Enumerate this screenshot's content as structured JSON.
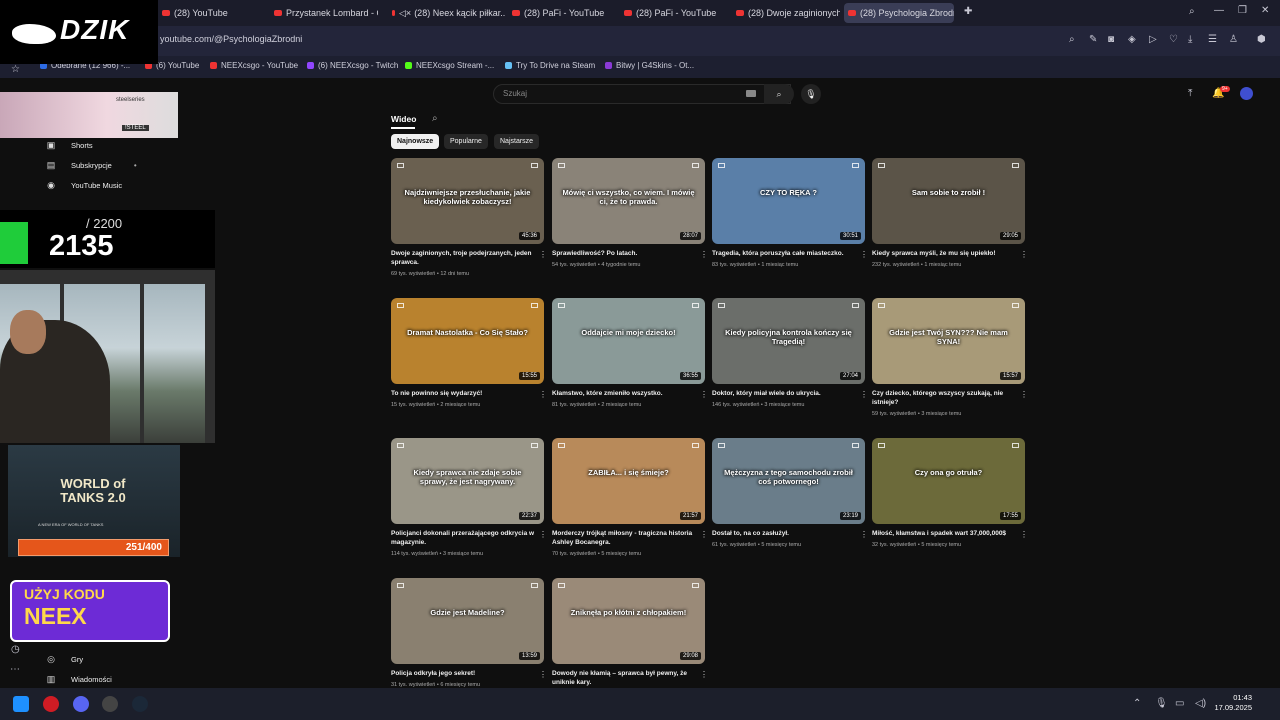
{
  "tabs": [
    {
      "label": "(28) YouTube"
    },
    {
      "label": "Przystanek Lombard - Od..."
    },
    {
      "label": "(28) Neex kącik piłkar..."
    },
    {
      "label": "(28) PaFi - YouTube"
    },
    {
      "label": "(28) PaFi - YouTube"
    },
    {
      "label": "(28) Dwoje zaginionych, t..."
    },
    {
      "label": "(28) Psychologia Zbrodni"
    }
  ],
  "address": {
    "url": "youtube.com/@PsychologiaZbrodni"
  },
  "bookmarks": [
    {
      "label": "Odebrane (12 966) -...",
      "color": "#2d6be4"
    },
    {
      "label": "(6) YouTube",
      "color": "#e33"
    },
    {
      "label": "NEEXcsgo - YouTube",
      "color": "#e33"
    },
    {
      "label": "(6) NEEXcsgo - Twitch",
      "color": "#9146ff"
    },
    {
      "label": "NEEXcsgo Stream -...",
      "color": "#53fc18"
    },
    {
      "label": "Try To Drive na Steam",
      "color": "#66c0f4"
    },
    {
      "label": "Bitwy | G4Skins - Ot...",
      "color": "#8a3ad6"
    }
  ],
  "search": {
    "placeholder": "Szukaj"
  },
  "sidebar": {
    "items": [
      {
        "label": "Shorts",
        "icon": "shorts-icon"
      },
      {
        "label": "Subskrypcje",
        "icon": "subscriptions-icon"
      },
      {
        "label": "YouTube Music",
        "icon": "music-icon"
      },
      {
        "label": "Gry",
        "icon": "games-icon"
      },
      {
        "label": "Wiadomości",
        "icon": "news-icon"
      }
    ]
  },
  "channel": {
    "tab_label": "Wideo",
    "chips": [
      "Najnowsze",
      "Popularne",
      "Najstarsze"
    ]
  },
  "videos": [
    {
      "title": "Dwoje zaginionych, troje podejrzanych, jeden sprawca.",
      "views": "69 tys. wyświetleń",
      "age": "12 dni temu",
      "duration": "45:36",
      "caption": "Najdziwniejsze przesłuchanie, jakie kiedykolwiek zobaczysz!",
      "bg": "#6a6050"
    },
    {
      "title": "Sprawiedliwość? Po latach.",
      "views": "54 tys. wyświetleń",
      "age": "4 tygodnie temu",
      "duration": "28:07",
      "caption": "Mówię ci wszystko, co wiem. I mówię ci, że to prawda.",
      "bg": "#8a8378"
    },
    {
      "title": "Tragedia, która poruszyła całe miasteczko.",
      "views": "83 tys. wyświetleń",
      "age": "1 miesiąc temu",
      "duration": "30:51",
      "caption": "CZY TO RĘKA ?",
      "bg": "#5a7fa8"
    },
    {
      "title": "Kiedy sprawca myśli, że mu się upiekło!",
      "views": "232 tys. wyświetleń",
      "age": "1 miesiąc temu",
      "duration": "29:05",
      "caption": "Sam sobie to zrobił !",
      "bg": "#5b5448"
    },
    {
      "title": "To nie powinno się wydarzyć!",
      "views": "15 tys. wyświetleń",
      "age": "2 miesiące temu",
      "duration": "15:55",
      "caption": "Dramat Nastolatka - Co Się Stało?",
      "bg": "#b9822e"
    },
    {
      "title": "Kłamstwo, które zmieniło wszystko.",
      "views": "81 tys. wyświetleń",
      "age": "2 miesiące temu",
      "duration": "36:55",
      "caption": "Oddajcie mi moje dziecko!",
      "bg": "#8a9a98"
    },
    {
      "title": "Doktor, który miał wiele do ukrycia.",
      "views": "146 tys. wyświetleń",
      "age": "3 miesiące temu",
      "duration": "27:04",
      "caption": "Kiedy policyjna kontrola kończy się Tragedią!",
      "bg": "#6b6e6a"
    },
    {
      "title": "Czy dziecko, którego wszyscy szukają, nie istnieje?",
      "views": "59 tys. wyświetleń",
      "age": "3 miesiące temu",
      "duration": "15:57",
      "caption": "Gdzie jest Twój SYN??? Nie mam SYNA!",
      "bg": "#a89a78"
    },
    {
      "title": "Policjanci dokonali przerażającego odkrycia w magazynie.",
      "views": "114 tys. wyświetleń",
      "age": "3 miesiące temu",
      "duration": "22:37",
      "caption": "Kiedy sprawca nie zdaje sobie sprawy, że jest nagrywany.",
      "bg": "#9a9688"
    },
    {
      "title": "Morderczy trójkąt miłosny - tragiczna historia Ashley Bocanegra.",
      "views": "70 tys. wyświetleń",
      "age": "5 miesięcy temu",
      "duration": "21:57",
      "caption": "ZABIŁA... i się śmieje?",
      "bg": "#b88a5a"
    },
    {
      "title": "Dostał to, na co zasłużył.",
      "views": "61 tys. wyświetleń",
      "age": "5 miesięcy temu",
      "duration": "23:19",
      "caption": "Mężczyzna z tego samochodu zrobił coś potwornego!",
      "bg": "#6a7d8a"
    },
    {
      "title": "Miłość, kłamstwa i spadek wart 37,000,000$",
      "views": "32 tys. wyświetleń",
      "age": "5 miesięcy temu",
      "duration": "17:55",
      "caption": "Czy ona go otruła?",
      "bg": "#6c6a3a"
    },
    {
      "title": "Policja odkryła jego sekret!",
      "views": "31 tys. wyświetleń",
      "age": "6 miesięcy temu",
      "duration": "13:59",
      "caption": "Gdzie jest Madeline?",
      "bg": "#8a8070"
    },
    {
      "title": "Dowody nie kłamią – sprawca był pewny, że uniknie kary.",
      "views": "",
      "age": "",
      "duration": "29:08",
      "caption": "Zniknęła po kłótni z chłopakiem!",
      "bg": "#9a8a78"
    }
  ],
  "overlay": {
    "brand": "DZIK",
    "steel": {
      "logo": "steelseries",
      "code": "!STEEL"
    },
    "counter": {
      "current": "2135",
      "total": "/ 2200"
    },
    "wot": {
      "title": "WORLD of TANKS 2.0",
      "subtitle": "A NEW ERA OF WORLD OF TANKS",
      "progress": "251/400"
    },
    "promo": {
      "line1": "UŻYJ KODU",
      "line2": "NEEX"
    }
  },
  "taskbar": {
    "time": "01:43",
    "date": "17.09.2025"
  },
  "colors": {
    "accent": "#ff0000",
    "bg": "#0f0f0f"
  }
}
